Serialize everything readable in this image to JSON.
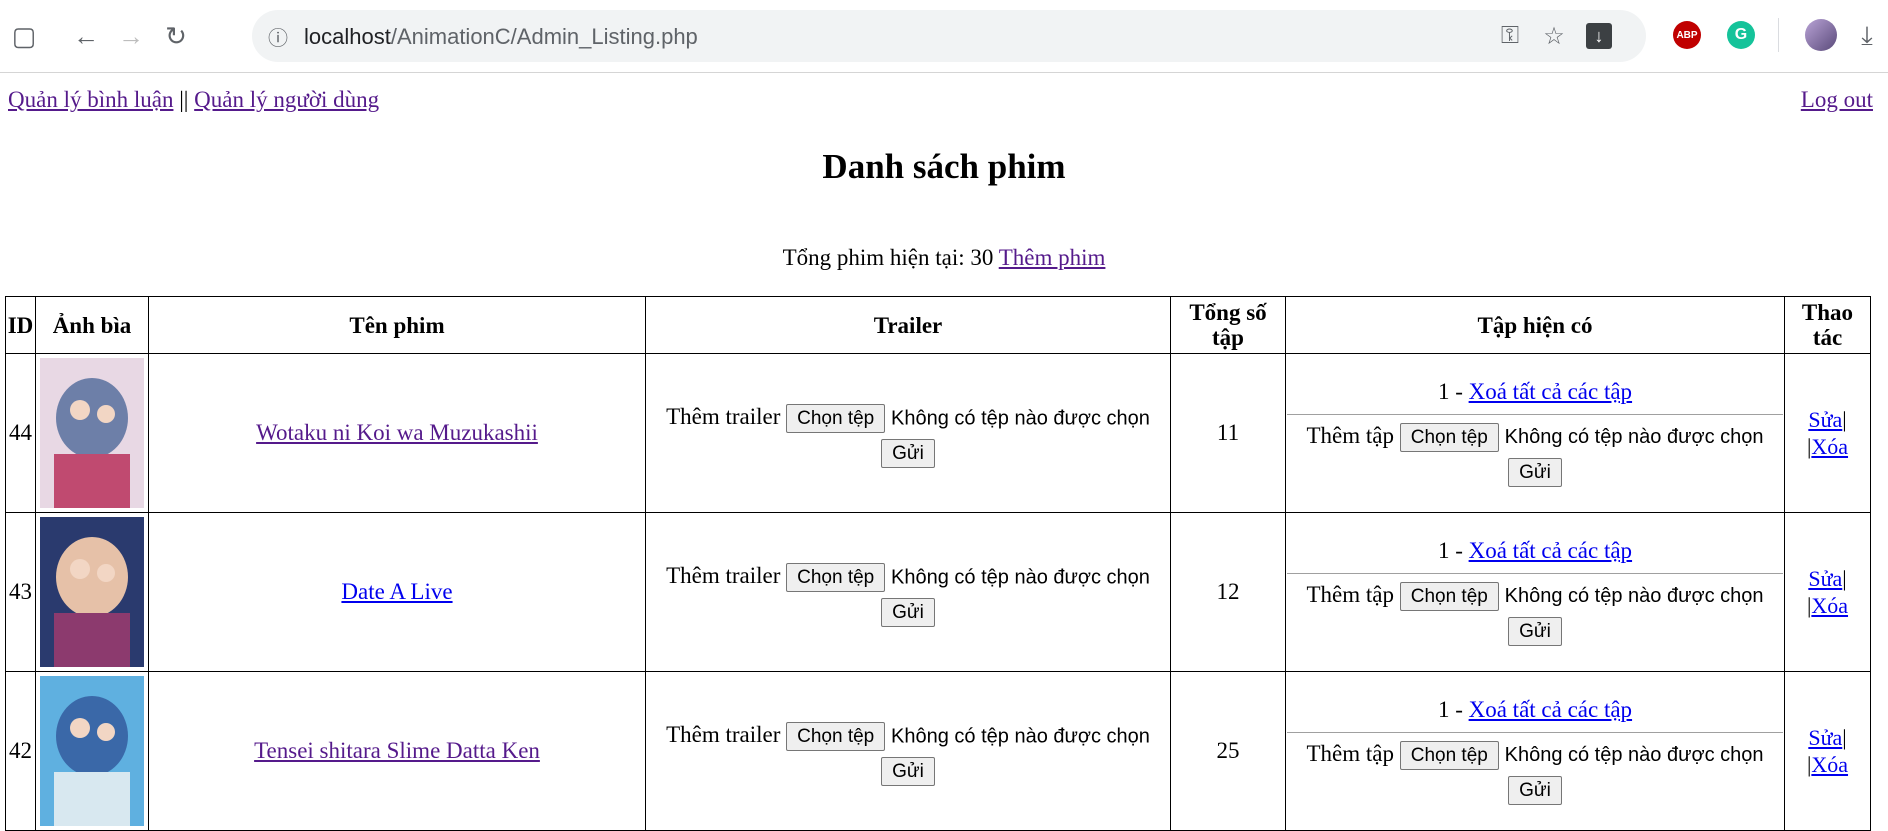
{
  "browser": {
    "url_host": "localhost",
    "url_path": "/AnimationC/Admin_Listing.php",
    "ext_abp": "ABP"
  },
  "nav": {
    "comments": "Quản lý bình luận",
    "sep": " || ",
    "users": "Quản lý người dùng",
    "logout": "Log out"
  },
  "page": {
    "title": "Danh sách phim",
    "total_label": "Tổng phim hiện tại: 30 ",
    "add_movie": "Thêm phim"
  },
  "table": {
    "headers": [
      "ID",
      "Ảnh bìa",
      "Tên phim",
      "Trailer",
      "Tổng số tập",
      "Tập hiện có",
      "Thao tác"
    ],
    "rows": [
      {
        "id": "44",
        "name": "Wotaku ni Koi wa Muzukashii",
        "episodes_total": "11",
        "episodes_current": "1 - ",
        "cover_colors": [
          "#e8d8e4",
          "#6d7fa8",
          "#c04a70"
        ],
        "name_visited": true
      },
      {
        "id": "43",
        "name": "Date A Live",
        "episodes_total": "12",
        "episodes_current": "1 - ",
        "cover_colors": [
          "#2a3a6e",
          "#e6c1a8",
          "#8c3a6e"
        ],
        "name_visited": false
      },
      {
        "id": "42",
        "name": "Tensei shitara Slime Datta Ken",
        "episodes_total": "25",
        "episodes_current": "1 - ",
        "cover_colors": [
          "#5fb0e0",
          "#3a68a8",
          "#d8e8f0"
        ],
        "name_visited": true
      }
    ],
    "trailer_label": "Thêm trailer",
    "episode_label": "Thêm tập",
    "choose_file": "Chọn tệp",
    "no_file": "Không có tệp nào được chọn",
    "submit": "Gửi",
    "delete_all": "Xoá tất cả các tập",
    "edit": "Sửa",
    "delete": "Xóa",
    "action_sep": "|"
  }
}
